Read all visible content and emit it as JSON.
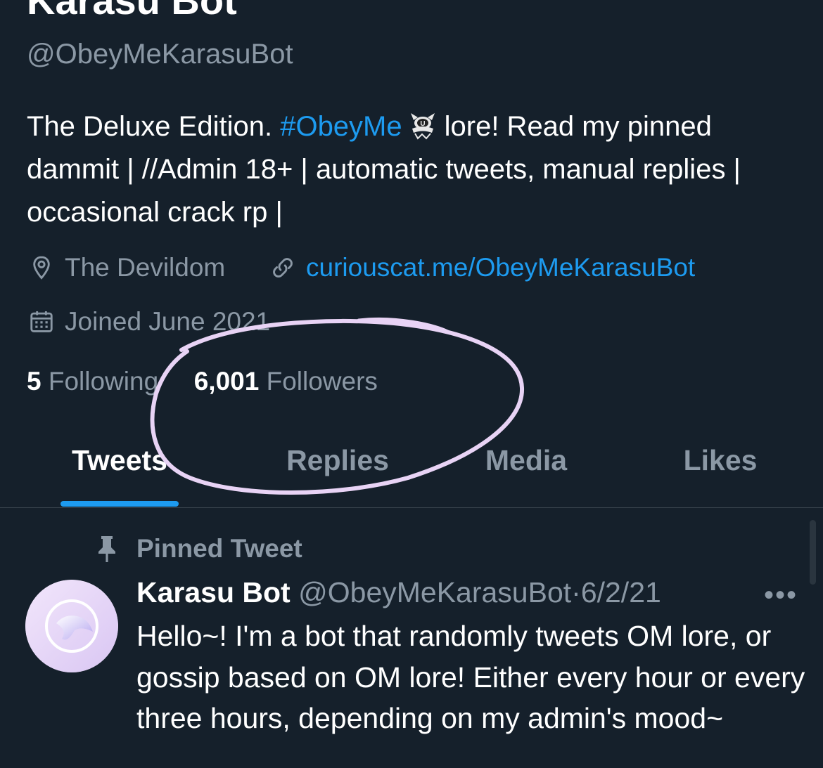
{
  "profile": {
    "display_name": "Karasu Bot",
    "handle": "@ObeyMeKarasuBot",
    "bio": {
      "text_1": "The Deluxe Edition. ",
      "hashtag": "#ObeyMe",
      "emoji_icon": "obeyme-emoji-icon",
      "text_2": "lore! Read my pinned dammit | //Admin 18+ | automatic tweets, manual replies | occasional crack rp |"
    },
    "location": "The Devildom",
    "website": "curiouscat.me/ObeyMeKarasuBot",
    "joined": "Joined June 2021",
    "following_count": "5",
    "following_label": "Following",
    "followers_count": "6,001",
    "followers_label": "Followers"
  },
  "tabs": [
    {
      "label": "Tweets",
      "active": true
    },
    {
      "label": "Replies",
      "active": false
    },
    {
      "label": "Media",
      "active": false
    },
    {
      "label": "Likes",
      "active": false
    }
  ],
  "pinned_tweet": {
    "pinned_label": "Pinned Tweet",
    "author_name": "Karasu Bot",
    "author_handle": "@ObeyMeKarasuBot",
    "separator": "·",
    "date": "6/2/21",
    "more_icon": "•••",
    "text": "Hello~! I'm a bot that randomly tweets OM lore, or gossip based on OM lore! Either every hour or every three hours, depending on my admin's mood~"
  },
  "colors": {
    "background": "#15202b",
    "accent": "#1d9bf0",
    "secondary_text": "#8b98a5",
    "annotation": "#e8d3f5"
  }
}
